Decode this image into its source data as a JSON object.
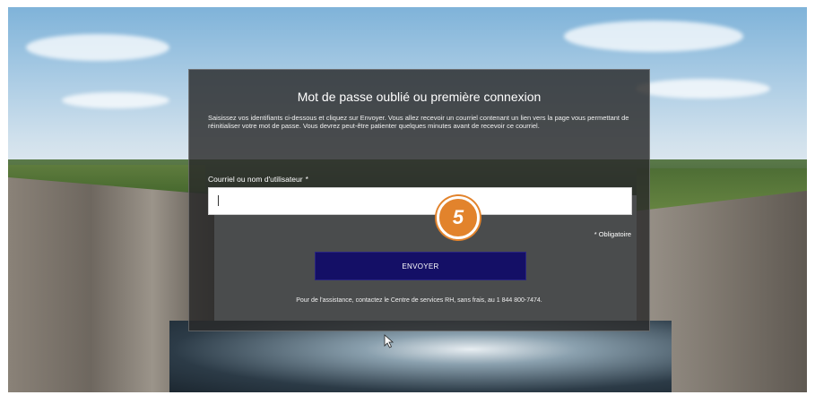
{
  "dialog": {
    "title": "Mot de passe oublié ou première connexion",
    "description": "Saisissez vos identifiants ci-dessous et cliquez sur Envoyer. Vous allez recevoir un courriel contenant un lien vers la page vous permettant de réinitialiser votre mot de passe. Vous devrez peut-être patienter quelques minutes avant de recevoir ce courriel.",
    "field_label": "Courriel ou nom d'utilisateur",
    "field_required_marker": "*",
    "field_value": "",
    "required_note": "* Obligatoire",
    "submit_label": "ENVOYER",
    "help_text": "Pour de l'assistance, contactez le Centre de services RH, sans frais, au 1 844 800-7474."
  },
  "annotation": {
    "step_number": "5",
    "color": "#e2832c"
  },
  "colors": {
    "submit_bg": "#140f66",
    "overlay_bg": "#2a2a2a"
  },
  "icons": {
    "cursor": "mouse-pointer-icon"
  }
}
